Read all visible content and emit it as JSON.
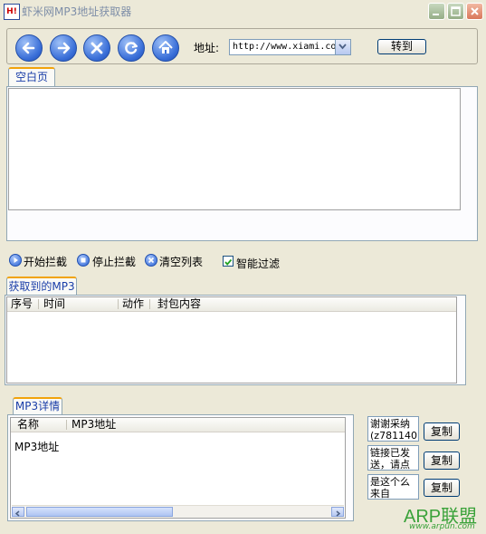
{
  "window": {
    "title": "虾米网MP3地址获取器",
    "app_icon_text": "H!"
  },
  "toolbar": {
    "nav_buttons": [
      {
        "name": "back",
        "icon": "arrow-left-icon"
      },
      {
        "name": "forward",
        "icon": "arrow-right-icon"
      },
      {
        "name": "stop",
        "icon": "close-icon"
      },
      {
        "name": "refresh",
        "icon": "refresh-icon"
      },
      {
        "name": "home",
        "icon": "home-icon"
      }
    ],
    "address_label": "地址:",
    "address_value": "http://www.xiami.co",
    "go_label": "转到"
  },
  "browser": {
    "tab_label": "空白页"
  },
  "controls": {
    "start_label": "开始拦截",
    "stop_label": "停止拦截",
    "clear_label": "清空列表",
    "filter_label": "智能过滤",
    "filter_checked": true
  },
  "captured": {
    "tab_label": "获取到的MP3",
    "columns": [
      "序号",
      "时间",
      "动作",
      "封包内容"
    ]
  },
  "details": {
    "tab_label": "MP3详情",
    "columns": [
      "名称",
      "MP3地址"
    ],
    "rows": [
      {
        "name": "MP3地址",
        "value": ""
      }
    ]
  },
  "side": {
    "notes": [
      "谢谢采纳(z781140",
      "链接已发送，请点",
      "是这个么来自"
    ],
    "copy_label": "复制"
  },
  "watermark": {
    "brand": "ARP联盟",
    "url": "www.arpun.com"
  },
  "colors": {
    "accent": "#f1a30c",
    "link_blue": "#1a3ea8",
    "nav_blue": "#3a6fd8"
  }
}
